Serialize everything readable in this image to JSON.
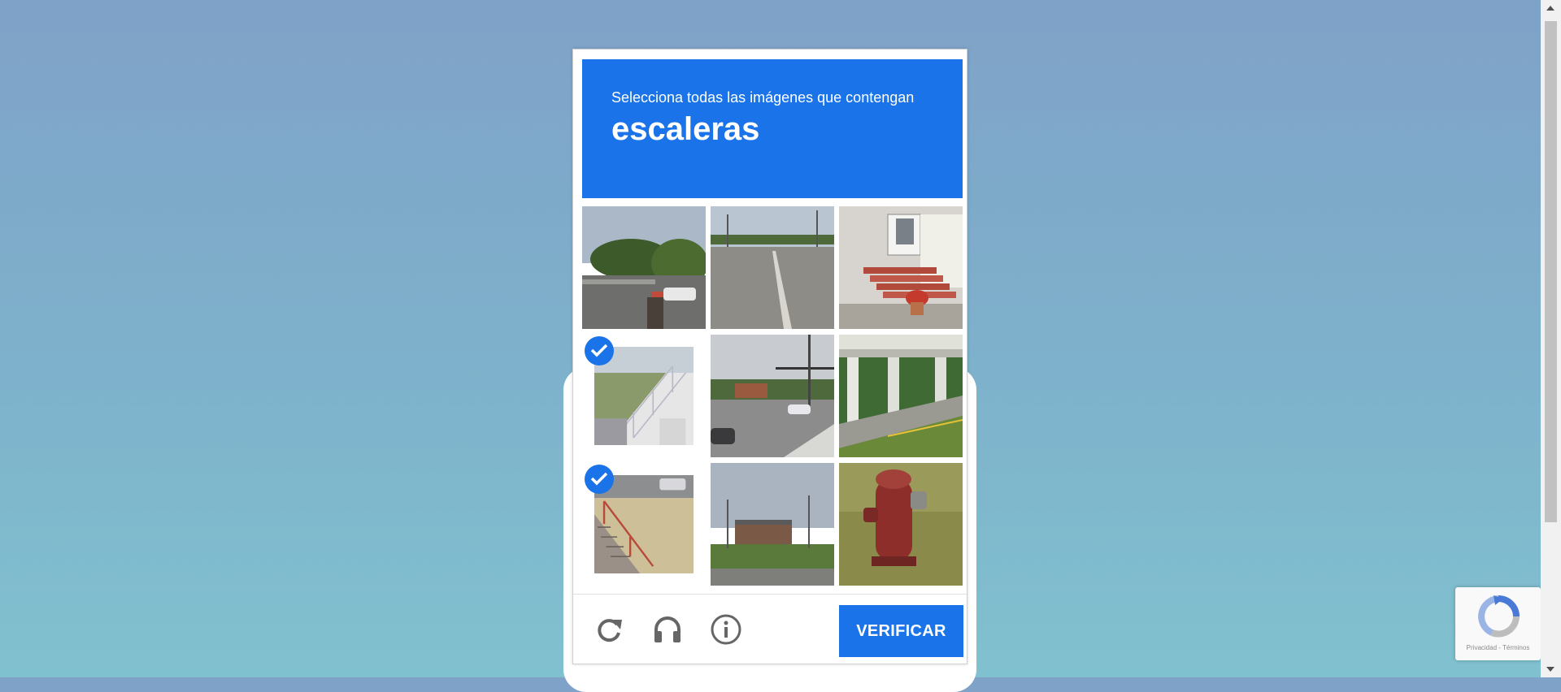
{
  "captcha": {
    "instruction": "Selecciona todas las imágenes que contengan",
    "target_object": "escaleras",
    "verify_label": "VERIFICAR",
    "accent_color": "#1a73e8",
    "tiles": [
      {
        "scene": "street-with-trees-and-parked-car",
        "selected": false
      },
      {
        "scene": "empty-road",
        "selected": false
      },
      {
        "scene": "house-porch-steps-with-flowerpot",
        "selected": false
      },
      {
        "scene": "white-stairs-with-railing",
        "selected": true
      },
      {
        "scene": "intersection-with-traffic-lights",
        "selected": false
      },
      {
        "scene": "overpass-columns-by-road",
        "selected": false
      },
      {
        "scene": "outdoor-stairs-with-red-railing",
        "selected": true
      },
      {
        "scene": "building-behind-field",
        "selected": false
      },
      {
        "scene": "red-fire-hydrant-on-grass",
        "selected": false
      }
    ],
    "footer_icons": [
      "reload-icon",
      "headphones-icon",
      "info-icon"
    ]
  },
  "badge": {
    "links": "Privacidad - Términos",
    "icon": "recaptcha-logo-icon"
  }
}
